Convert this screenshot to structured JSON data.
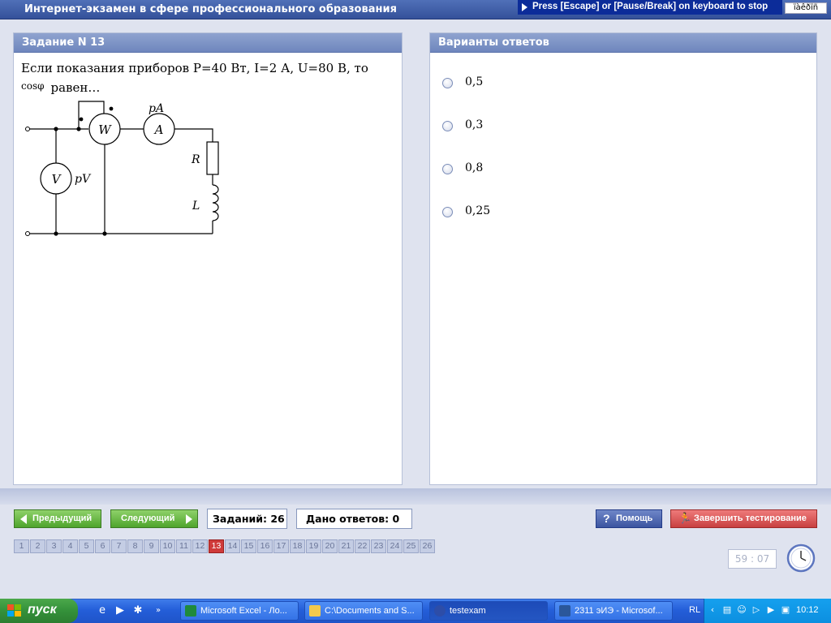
{
  "header": {
    "title": "Интернет-экзамен в сфере профессионального образования",
    "escape_hint": "Press [Escape] or [Pause/Break] on keyboard to stop",
    "keyboard_box": "ïàêðïñ"
  },
  "task_panel": {
    "heading": "Задание N 13",
    "question_line1": "Если показания приборов P=40 Вт, I=2 А, U=80 В, то",
    "question_cos": "cosφ",
    "question_line2": "равен…",
    "circuit_labels": {
      "wattmeter": "W",
      "ammeter": "A",
      "ammeter_name": "pA",
      "voltmeter": "V",
      "voltmeter_name": "pV",
      "resistor": "R",
      "inductor": "L"
    }
  },
  "answers_panel": {
    "heading": "Варианты ответов",
    "options": [
      "0,5",
      "0,3",
      "0,8",
      "0,25"
    ]
  },
  "nav": {
    "prev_label": "Предыдущий",
    "next_label": "Следующий",
    "tasks_count": "Заданий: 26",
    "answers_given": "Дано ответов: 0",
    "help_label": "Помощь",
    "finish_label": "Завершить тестирование",
    "current_task": 13,
    "task_numbers": [
      "1",
      "2",
      "3",
      "4",
      "5",
      "6",
      "7",
      "8",
      "9",
      "10",
      "11",
      "12",
      "13",
      "14",
      "15",
      "16",
      "17",
      "18",
      "19",
      "20",
      "21",
      "22",
      "23",
      "24",
      "25",
      "26"
    ],
    "timer": "59 : 07"
  },
  "taskbar": {
    "start_label": "пуск",
    "items": [
      {
        "label": "Microsoft Excel - Ло...",
        "icon": "excel-icon"
      },
      {
        "label": "C:\\Documents and S...",
        "icon": "folder-icon"
      },
      {
        "label": "testexam",
        "icon": "testexam-icon"
      },
      {
        "label": "2311 эИЭ - Microsof...",
        "icon": "word-icon"
      }
    ],
    "language": "RL",
    "clock": "10:12"
  },
  "colors": {
    "header_bg": "#34519a",
    "panel_head": "#7e93c6",
    "nav_green": "#4ea42c",
    "help_blue": "#3b54a0",
    "finish_red": "#c84040",
    "current_task_red": "#cf3a3a",
    "taskbar_blue": "#245ed9"
  }
}
